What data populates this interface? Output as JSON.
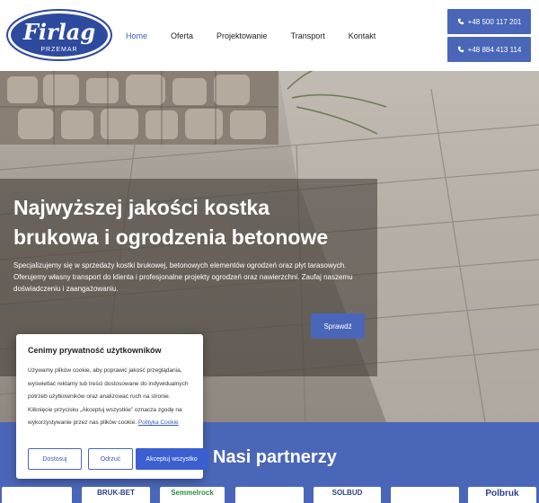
{
  "header": {
    "logo": {
      "name": "Firlag",
      "sub": "PRZEMAR"
    },
    "nav": [
      {
        "label": "Home",
        "active": true
      },
      {
        "label": "Oferta",
        "active": false
      },
      {
        "label": "Projektowanie",
        "active": false
      },
      {
        "label": "Transport",
        "active": false
      },
      {
        "label": "Kontakt",
        "active": false
      }
    ],
    "phones": [
      "+48 500 117 201",
      "+48 884 413 114"
    ]
  },
  "hero": {
    "title": "Najwyższej jakości kostka brukowa i ogrodzenia betonowe",
    "text": "Specjalizujemy się w sprzedaży kostki brukowej, betonowych elementów ogrodzeń oraz płyt tarasowych. Oferujemy własny transport do klienta i profesjonalne projekty ogrodzeń oraz nawierzchni. Zaufaj naszemu doświadczeniu i zaangażowaniu.",
    "button": "Sprawdź"
  },
  "partners": {
    "title": "Nasi partnerzy",
    "logos": [
      "",
      "BRUK-BET",
      "Semmelrock",
      "",
      "SOLBUD",
      "",
      "Polbruk"
    ]
  },
  "cookie": {
    "title": "Cenimy prywatność użytkowników",
    "text": "Używamy plików cookie, aby poprawić jakość przeglądania, wyświetlać reklamy lub treści dostosowane do indywidualnych potrzeb użytkowników oraz analizować ruch na stronie. Kliknięcie przycisku „Akceptuj wszystkie” oznacza zgodę na wykorzystywanie przez nas plików cookie.",
    "link": "Polityka Cookie",
    "buttons": {
      "customize": "Dostosuj",
      "reject": "Odrzuć",
      "accept": "Akceptuj wszystko"
    }
  },
  "colors": {
    "brand": "#4a66b8",
    "accept": "#3b5fd1"
  }
}
